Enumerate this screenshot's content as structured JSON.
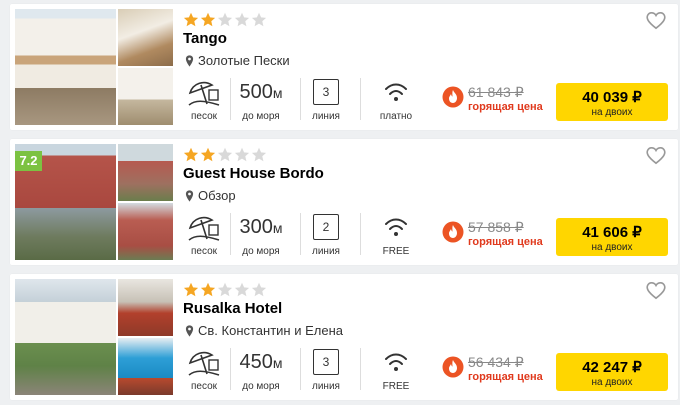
{
  "hotels": [
    {
      "name": "Tango",
      "stars": 2,
      "max_stars": 5,
      "rating": "",
      "location": "Золотые Пески",
      "beach_label": "песок",
      "distance_value": "500",
      "distance_unit": "м",
      "distance_label": "до моря",
      "line_value": "3",
      "line_label": "линия",
      "wifi_label": "платно",
      "old_price": "61 843 ₽",
      "hot_label": "горящая цена",
      "price": "40 039 ₽",
      "price_label": "на двоих"
    },
    {
      "name": "Guest House Bordo",
      "stars": 2,
      "max_stars": 5,
      "rating": "7.2",
      "location": "Обзор",
      "beach_label": "песок",
      "distance_value": "300",
      "distance_unit": "м",
      "distance_label": "до моря",
      "line_value": "2",
      "line_label": "линия",
      "wifi_label": "FREE",
      "old_price": "57 858 ₽",
      "hot_label": "горящая цена",
      "price": "41 606 ₽",
      "price_label": "на двоих"
    },
    {
      "name": "Rusalka Hotel",
      "stars": 2,
      "max_stars": 5,
      "rating": "",
      "location": "Св. Константин и Елена",
      "beach_label": "песок",
      "distance_value": "450",
      "distance_unit": "м",
      "distance_label": "до моря",
      "line_value": "3",
      "line_label": "линия",
      "wifi_label": "FREE",
      "old_price": "56 434 ₽",
      "hot_label": "горящая цена",
      "price": "42 247 ₽",
      "price_label": "на двоих"
    }
  ],
  "icons": {
    "star_filled": "star-icon",
    "heart": "heart-icon",
    "location": "location-pin-icon",
    "beach": "beach-umbrella-icon",
    "wifi": "wifi-icon",
    "hot": "fire-icon"
  },
  "colors": {
    "star_filled": "#f5a623",
    "star_empty": "#d9d9d9",
    "rating_badge": "#7cc242",
    "hot_text": "#e03a1e",
    "price_button": "#ffd600"
  }
}
